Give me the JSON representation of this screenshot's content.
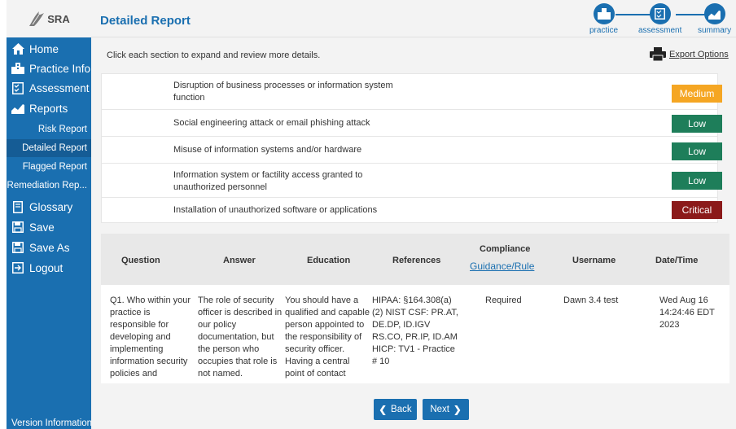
{
  "app": {
    "logo_text": "SRA"
  },
  "header": {
    "title": "Detailed Report",
    "steps": [
      {
        "label": "practice",
        "icon": "building-icon"
      },
      {
        "label": "assessment",
        "icon": "checklist-icon"
      },
      {
        "label": "summary",
        "icon": "chart-icon"
      }
    ]
  },
  "sidebar": {
    "items": [
      {
        "label": "Home",
        "icon": "home-icon"
      },
      {
        "label": "Practice Info",
        "icon": "building-icon"
      },
      {
        "label": "Assessment",
        "icon": "checklist-icon"
      },
      {
        "label": "Reports",
        "icon": "chart-icon"
      }
    ],
    "sub_items": [
      "Risk Report",
      "Detailed Report",
      "Flagged Report",
      "Remediation Rep..."
    ],
    "active_sub": "Detailed Report",
    "bottom_items": [
      {
        "label": "Glossary",
        "icon": "book-icon"
      },
      {
        "label": "Save",
        "icon": "floppy-icon"
      },
      {
        "label": "Save As",
        "icon": "floppy-icon"
      },
      {
        "label": "Logout",
        "icon": "logout-icon"
      }
    ],
    "version": "Version Information"
  },
  "toolbar": {
    "instruction": "Click each section to expand and review more details.",
    "export_label": "Export Options"
  },
  "threats": [
    {
      "text": "Disruption of business processes or information system function",
      "risk": "Medium",
      "color": "#f5a623"
    },
    {
      "text": "Social engineering attack or email phishing attack",
      "risk": "Low",
      "color": "#1e7e5a"
    },
    {
      "text": "Misuse of information systems and/or hardware",
      "risk": "Low",
      "color": "#1e7e5a"
    },
    {
      "text": "Information system or factility access granted to unauthorized personnel",
      "risk": "Low",
      "color": "#1e7e5a"
    },
    {
      "text": "Installation of unauthorized software or applications",
      "risk": "Critical",
      "color": "#8b1a1a"
    }
  ],
  "table": {
    "headers": {
      "question": "Question",
      "answer": "Answer",
      "education": "Education",
      "references": "References",
      "compliance": "Compliance",
      "compliance_link": "Guidance/Rule",
      "username": "Username",
      "datetime": "Date/Time"
    },
    "row": {
      "question": "Q1. Who within your practice is responsible for developing and implementing information security policies and",
      "answer": "The role of security officer is described in our policy documentation, but the person who occupies that role is not named.",
      "education": "You should have a qualified and capable person appointed to the responsibility of security officer. Having a central point of contact",
      "references": "HIPAA: §164.308(a)(2) NIST CSF: PR.AT, DE.DP, ID.IGV RS.CO, PR.IP, ID.AM HICP: TV1 - Practice # 10",
      "compliance": "Required",
      "username": "Dawn 3.4 test",
      "datetime": "Wed Aug 16 14:24:46 EDT 2023"
    }
  },
  "buttons": {
    "back": "Back",
    "next": "Next"
  },
  "colors": {
    "brand": "#1a6fb0",
    "sidebar_active": "#155c95"
  }
}
